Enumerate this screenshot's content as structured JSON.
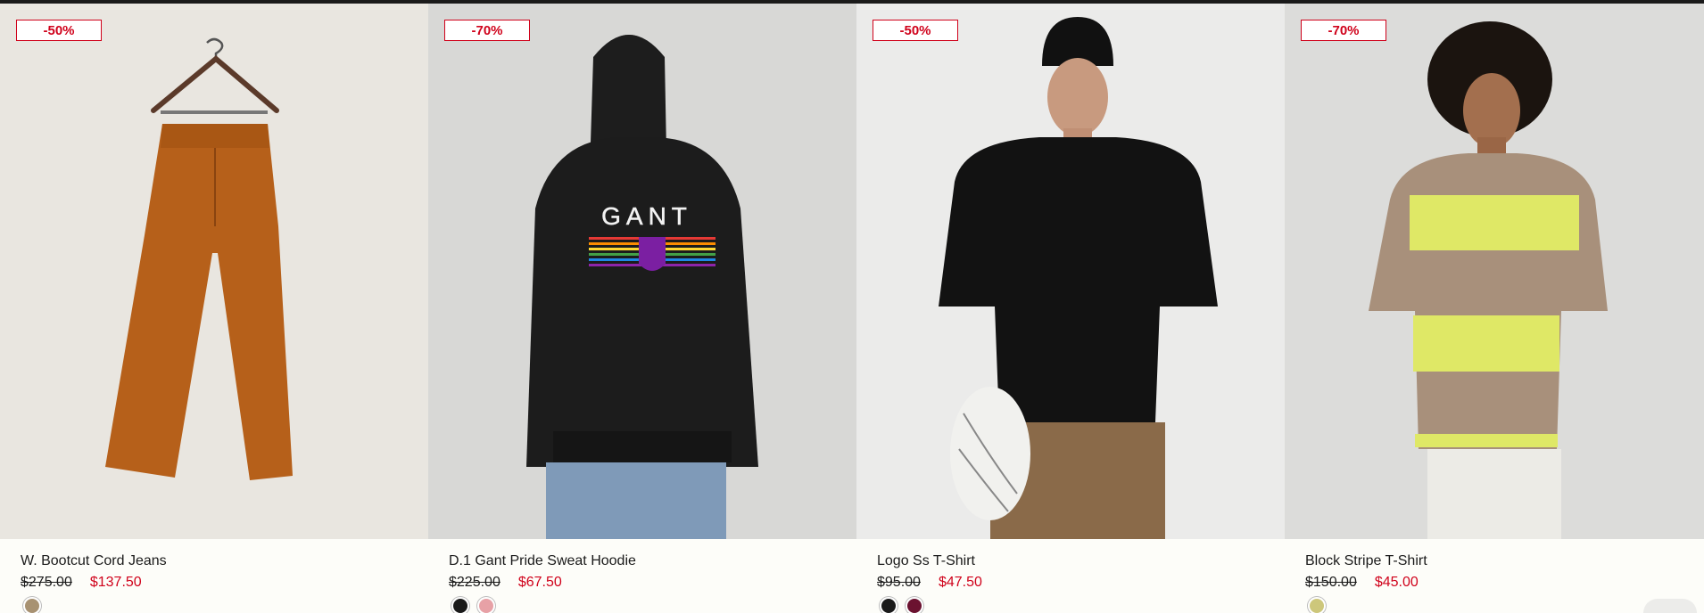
{
  "products": [
    {
      "discount": "-50%",
      "name": "W. Bootcut Cord Jeans",
      "old_price": "$275.00",
      "new_price": "$137.50",
      "image_icon": "corduroy-jeans-on-hanger",
      "bg": "#e8e5df",
      "swatches": [
        "#a89272"
      ]
    },
    {
      "discount": "-70%",
      "name": "D.1 Gant Pride Sweat Hoodie",
      "old_price": "$225.00",
      "new_price": "$67.50",
      "image_icon": "black-hoodie-model",
      "bg": "#d7d7d5",
      "swatches": [
        "#1a1a1a",
        "#e7a1a6"
      ]
    },
    {
      "discount": "-50%",
      "name": "Logo Ss T-Shirt",
      "old_price": "$95.00",
      "new_price": "$47.50",
      "image_icon": "black-tshirt-model",
      "bg": "#e8e8e6",
      "swatches": [
        "#1a1a1a",
        "#6b1230"
      ]
    },
    {
      "discount": "-70%",
      "name": "Block Stripe T-Shirt",
      "old_price": "$150.00",
      "new_price": "$45.00",
      "image_icon": "striped-tshirt-model",
      "bg": "#dcdcda",
      "swatches": [
        "#cdc77b"
      ]
    }
  ]
}
